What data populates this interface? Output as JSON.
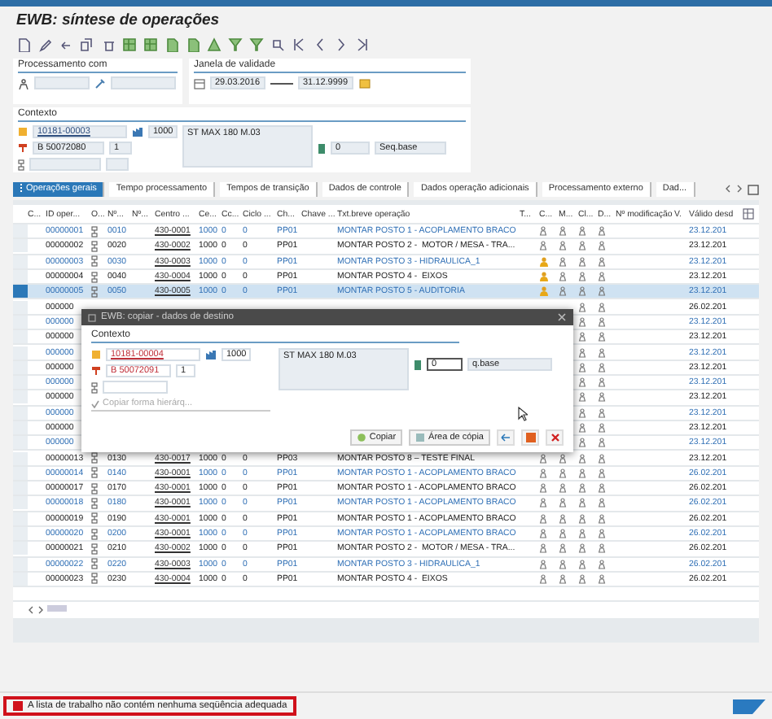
{
  "title": "EWB: síntese de operações",
  "processing": {
    "label": "Processamento com"
  },
  "validity": {
    "label": "Janela de validade",
    "from": "29.03.2016",
    "to": "31.12.9999"
  },
  "context": {
    "label": "Contexto",
    "material": "10181-00003",
    "plant": "1000",
    "description": "ST MAX 180 M.03",
    "prefix": "B",
    "number": "50072080",
    "counter": "1",
    "sequence": "0",
    "sequence_label": "Seq.base"
  },
  "tabs": [
    {
      "label": "Operações gerais",
      "selected": true
    },
    {
      "label": "Tempo processamento",
      "selected": false
    },
    {
      "label": "Tempos de transição",
      "selected": false
    },
    {
      "label": "Dados de controle",
      "selected": false
    },
    {
      "label": "Dados operação adicionais",
      "selected": false
    },
    {
      "label": "Processamento externo",
      "selected": false
    },
    {
      "label": "Dad...",
      "selected": false
    }
  ],
  "table": {
    "columns": [
      "C...",
      "ID oper...",
      "O...",
      "Nº...",
      "Nº...",
      "Centro ...",
      "Ce...",
      "Cc...",
      "Ciclo ...",
      "Ch...",
      "Chave ...",
      "Txt.breve operação",
      "T...",
      "C...",
      "M...",
      "Cl...",
      "D...",
      "Nº modificação",
      "V.",
      "Válido desd"
    ],
    "rows": [
      {
        "kind": "full",
        "id": "00000001",
        "op": "0010",
        "centro": "430-0001",
        "ce": "1000",
        "cc": "0",
        "ciclo": "0",
        "ch": "PP01",
        "text": "MONTAR POSTO 1 - ACOPLAMENTO BRACO",
        "assigned": false,
        "date": "23.12.201",
        "selected": false,
        "emphasized": true
      },
      {
        "kind": "full",
        "id": "00000002",
        "op": "0020",
        "centro": "430-0002",
        "ce": "1000",
        "cc": "0",
        "ciclo": "0",
        "ch": "PP01",
        "text": "MONTAR POSTO 2 -  MOTOR / MESA - TRA...",
        "assigned": false,
        "date": "23.12.201",
        "selected": false,
        "emphasized": false
      },
      {
        "kind": "full",
        "id": "00000003",
        "op": "0030",
        "centro": "430-0003",
        "ce": "1000",
        "cc": "0",
        "ciclo": "0",
        "ch": "PP01",
        "text": "MONTAR POSTO 3 - HIDRAULICA_1",
        "assigned": true,
        "date": "23.12.201",
        "selected": false,
        "emphasized": true
      },
      {
        "kind": "full",
        "id": "00000004",
        "op": "0040",
        "centro": "430-0004",
        "ce": "1000",
        "cc": "0",
        "ciclo": "0",
        "ch": "PP01",
        "text": "MONTAR POSTO 4 -  EIXOS",
        "assigned": true,
        "date": "23.12.201",
        "selected": false,
        "emphasized": false
      },
      {
        "kind": "full",
        "id": "00000005",
        "op": "0050",
        "centro": "430-0005",
        "ce": "1000",
        "cc": "0",
        "ciclo": "0",
        "ch": "PP01",
        "text": "MONTAR POSTO 5 - AUDITORIA",
        "assigned": true,
        "date": "23.12.201",
        "selected": true,
        "emphasized": true
      },
      {
        "kind": "covered",
        "id": "000000",
        "date": "26.02.201",
        "selected": false,
        "emphasized": false
      },
      {
        "kind": "covered",
        "id": "000000",
        "date": "23.12.201",
        "selected": false,
        "emphasized": true
      },
      {
        "kind": "covered",
        "id": "000000",
        "date": "23.12.201",
        "selected": false,
        "emphasized": false
      },
      {
        "kind": "covered",
        "id": "000000",
        "date": "23.12.201",
        "selected": false,
        "emphasized": true
      },
      {
        "kind": "covered",
        "id": "000000",
        "date": "23.12.201",
        "selected": false,
        "emphasized": false
      },
      {
        "kind": "covered",
        "id": "000000",
        "date": "23.12.201",
        "selected": false,
        "emphasized": true
      },
      {
        "kind": "covered",
        "id": "000000",
        "date": "23.12.201",
        "selected": false,
        "emphasized": false
      },
      {
        "kind": "covered",
        "id": "000000",
        "date": "23.12.201",
        "selected": false,
        "emphasized": true
      },
      {
        "kind": "covered",
        "id": "000000",
        "date": "23.12.201",
        "selected": false,
        "emphasized": false
      },
      {
        "kind": "covered",
        "id": "000000",
        "date": "23.12.201",
        "selected": false,
        "emphasized": true
      },
      {
        "kind": "full",
        "id": "00000013",
        "op": "0130",
        "centro": "430-0017",
        "ce": "1000",
        "cc": "0",
        "ciclo": "0",
        "ch": "PP03",
        "text": "MONTAR POSTO 8 – TESTE FINAL",
        "assigned": false,
        "date": "23.12.201",
        "selected": false,
        "emphasized": false
      },
      {
        "kind": "full",
        "id": "00000014",
        "op": "0140",
        "centro": "430-0001",
        "ce": "1000",
        "cc": "0",
        "ciclo": "0",
        "ch": "PP01",
        "text": "MONTAR POSTO 1 - ACOPLAMENTO BRACO",
        "assigned": false,
        "date": "26.02.201",
        "selected": false,
        "emphasized": true
      },
      {
        "kind": "full",
        "id": "00000017",
        "op": "0170",
        "centro": "430-0001",
        "ce": "1000",
        "cc": "0",
        "ciclo": "0",
        "ch": "PP01",
        "text": "MONTAR POSTO 1 - ACOPLAMENTO BRACO",
        "assigned": false,
        "date": "26.02.201",
        "selected": false,
        "emphasized": false
      },
      {
        "kind": "full",
        "id": "00000018",
        "op": "0180",
        "centro": "430-0001",
        "ce": "1000",
        "cc": "0",
        "ciclo": "0",
        "ch": "PP01",
        "text": "MONTAR POSTO 1 - ACOPLAMENTO BRACO",
        "assigned": false,
        "date": "26.02.201",
        "selected": false,
        "emphasized": true
      },
      {
        "kind": "full",
        "id": "00000019",
        "op": "0190",
        "centro": "430-0001",
        "ce": "1000",
        "cc": "0",
        "ciclo": "0",
        "ch": "PP01",
        "text": "MONTAR POSTO 1 - ACOPLAMENTO BRACO",
        "assigned": false,
        "date": "26.02.201",
        "selected": false,
        "emphasized": false
      },
      {
        "kind": "full",
        "id": "00000020",
        "op": "0200",
        "centro": "430-0001",
        "ce": "1000",
        "cc": "0",
        "ciclo": "0",
        "ch": "PP01",
        "text": "MONTAR POSTO 1 - ACOPLAMENTO BRACO",
        "assigned": false,
        "date": "26.02.201",
        "selected": false,
        "emphasized": true
      },
      {
        "kind": "full",
        "id": "00000021",
        "op": "0210",
        "centro": "430-0002",
        "ce": "1000",
        "cc": "0",
        "ciclo": "0",
        "ch": "PP01",
        "text": "MONTAR POSTO 2 -  MOTOR / MESA - TRA...",
        "assigned": false,
        "date": "26.02.201",
        "selected": false,
        "emphasized": false
      },
      {
        "kind": "full",
        "id": "00000022",
        "op": "0220",
        "centro": "430-0003",
        "ce": "1000",
        "cc": "0",
        "ciclo": "0",
        "ch": "PP01",
        "text": "MONTAR POSTO 3 - HIDRAULICA_1",
        "assigned": false,
        "date": "26.02.201",
        "selected": false,
        "emphasized": true
      },
      {
        "kind": "full",
        "id": "00000023",
        "op": "0230",
        "centro": "430-0004",
        "ce": "1000",
        "cc": "0",
        "ciclo": "0",
        "ch": "PP01",
        "text": "MONTAR POSTO 4 -  EIXOS",
        "assigned": false,
        "date": "26.02.201",
        "selected": false,
        "emphasized": false
      }
    ]
  },
  "dialog": {
    "title": "EWB: copiar - dados de destino",
    "context_label": "Contexto",
    "material": "10181-00004",
    "plant": "1000",
    "description": "ST MAX 180 M.03",
    "prefix": "B",
    "number": "50072091",
    "counter": "1",
    "sequence": "0",
    "sequence_label": "q.base",
    "checkbox": {
      "label": "Copiar forma hierárq...",
      "checked": true,
      "disabled": true
    },
    "buttons": [
      {
        "label": "Copiar"
      },
      {
        "label": "Área de cópia"
      }
    ]
  },
  "status": {
    "message": "A lista de trabalho não contém nenhuma seqüência adequada"
  }
}
